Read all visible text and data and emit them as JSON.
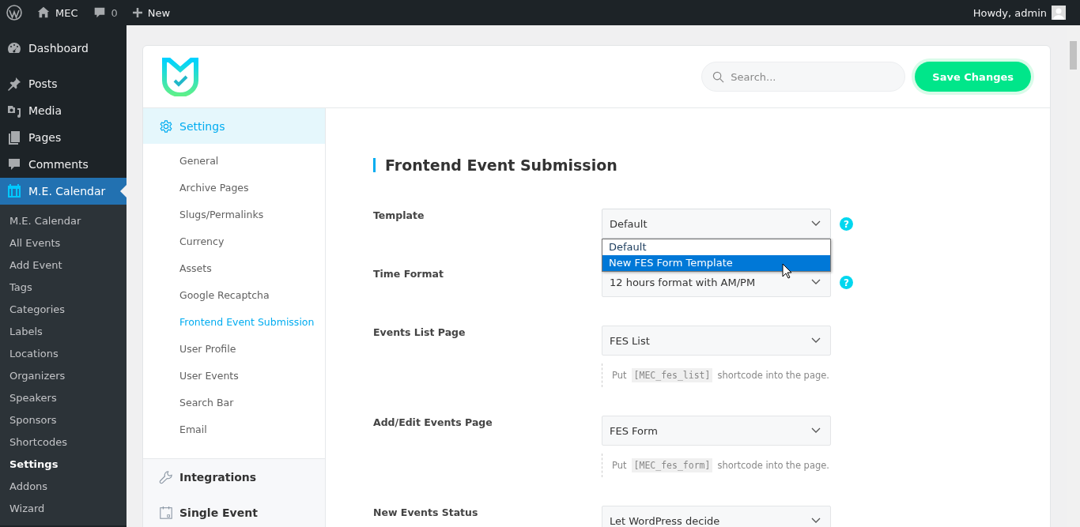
{
  "admin_bar": {
    "site": "MEC",
    "comments": "0",
    "new": "New",
    "greeting": "Howdy, admin"
  },
  "sidebar": {
    "items": [
      {
        "label": "Dashboard",
        "selected": false
      },
      {
        "label": "Posts",
        "selected": false
      },
      {
        "label": "Media",
        "selected": false
      },
      {
        "label": "Pages",
        "selected": false
      },
      {
        "label": "Comments",
        "selected": false
      },
      {
        "label": "M.E. Calendar",
        "selected": true
      }
    ],
    "submenu": [
      {
        "label": "M.E. Calendar",
        "selected": false
      },
      {
        "label": "All Events",
        "selected": false
      },
      {
        "label": "Add Event",
        "selected": false
      },
      {
        "label": "Tags",
        "selected": false
      },
      {
        "label": "Categories",
        "selected": false
      },
      {
        "label": "Labels",
        "selected": false
      },
      {
        "label": "Locations",
        "selected": false
      },
      {
        "label": "Organizers",
        "selected": false
      },
      {
        "label": "Speakers",
        "selected": false
      },
      {
        "label": "Sponsors",
        "selected": false
      },
      {
        "label": "Shortcodes",
        "selected": false
      },
      {
        "label": "Settings",
        "selected": true
      },
      {
        "label": "Addons",
        "selected": false
      },
      {
        "label": "Wizard",
        "selected": false
      }
    ]
  },
  "header": {
    "search": {
      "placeholder": "Search..."
    },
    "save_button": "Save Changes"
  },
  "settings_nav": {
    "sections": [
      {
        "label": "Settings",
        "expanded": true,
        "items": [
          {
            "label": "General",
            "selected": false
          },
          {
            "label": "Archive Pages",
            "selected": false
          },
          {
            "label": "Slugs/Permalinks",
            "selected": false
          },
          {
            "label": "Currency",
            "selected": false
          },
          {
            "label": "Assets",
            "selected": false
          },
          {
            "label": "Google Recaptcha",
            "selected": false
          },
          {
            "label": "Frontend Event Submission",
            "selected": true
          },
          {
            "label": "User Profile",
            "selected": false
          },
          {
            "label": "User Events",
            "selected": false
          },
          {
            "label": "Search Bar",
            "selected": false
          },
          {
            "label": "Email",
            "selected": false
          }
        ]
      },
      {
        "label": "Integrations",
        "expanded": false
      },
      {
        "label": "Single Event",
        "expanded": false
      }
    ]
  },
  "content": {
    "title": "Frontend Event Submission",
    "fields": [
      {
        "label": "Template",
        "value": "Default",
        "help": "?",
        "expanded": true,
        "options": [
          {
            "label": "Default",
            "highlighted": false
          },
          {
            "label": "New FES Form Template",
            "highlighted": true
          }
        ]
      },
      {
        "label": "Time Format",
        "value": "12 hours format with AM/PM",
        "help": "?"
      },
      {
        "label": "Events List Page",
        "value": "FES List",
        "hint": {
          "before": "Put",
          "code": "[MEC_fes_list]",
          "after": "shortcode into the page."
        }
      },
      {
        "label": "Add/Edit Events Page",
        "value": "FES Form",
        "hint": {
          "before": "Put",
          "code": "[MEC_fes_form]",
          "after": "shortcode into the page."
        }
      },
      {
        "label": "New Events Status",
        "value": "Let WordPress decide"
      }
    ]
  }
}
